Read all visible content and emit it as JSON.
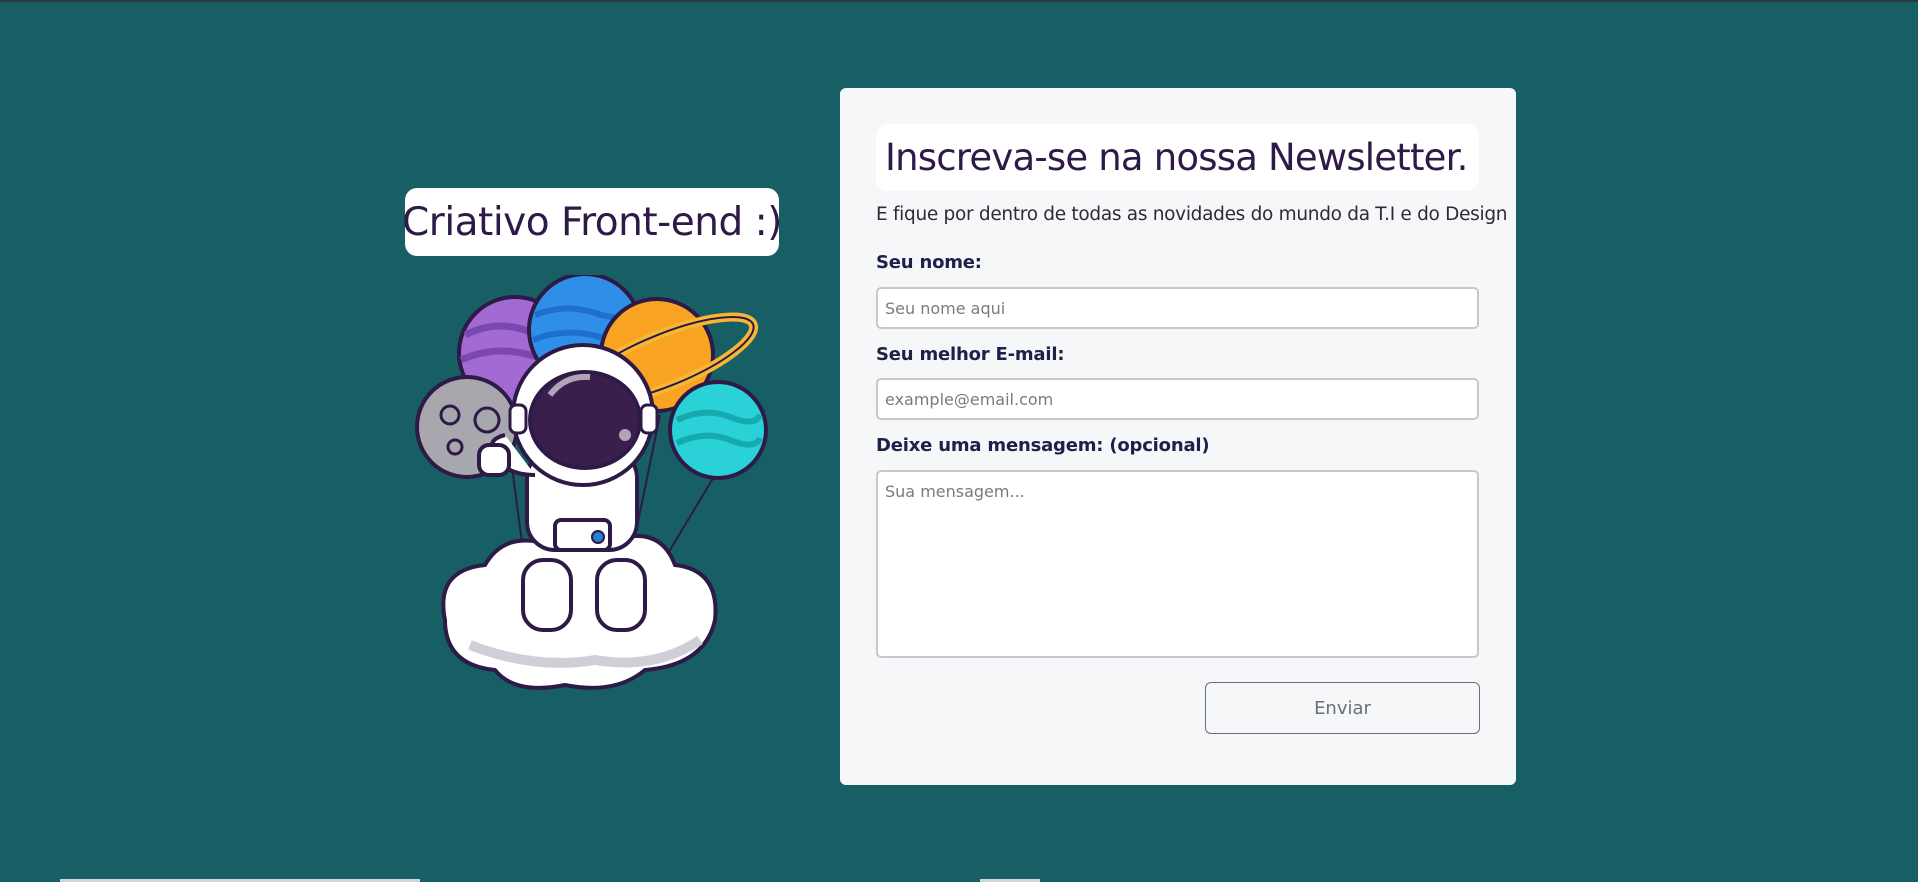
{
  "brand": {
    "title": "Criativo Front-end :)"
  },
  "form": {
    "title": "Inscreva-se na nossa Newsletter.",
    "subtitle": "E fique por dentro de todas as novidades do mundo da T.I e do Design",
    "name_label": "Seu nome:",
    "name_placeholder": "Seu nome aqui",
    "name_value": "",
    "email_label": "Seu melhor E-mail:",
    "email_placeholder": "example@email.com",
    "email_value": "",
    "message_label": "Deixe uma mensagem: (opcional)",
    "message_placeholder": "Sua mensagem...",
    "message_value": "",
    "submit_label": "Enviar"
  },
  "colors": {
    "background": "#175e65",
    "card": "#f6f7f9",
    "title_text": "#2e1a47",
    "label_text": "#1f1f4a"
  },
  "icons": {
    "illustration": "astronaut-with-planet-balloons-illustration"
  }
}
